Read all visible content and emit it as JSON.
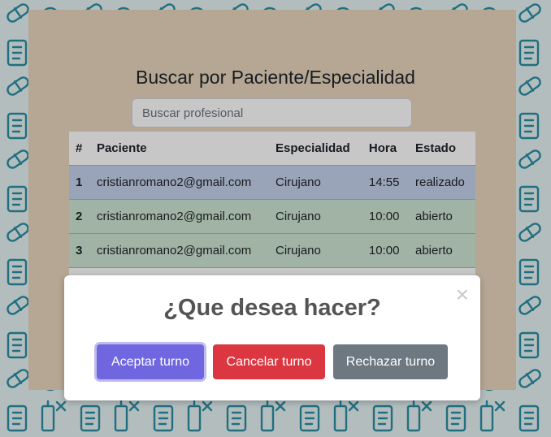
{
  "header": {
    "title": "Buscar por Paciente/Especialidad"
  },
  "search": {
    "placeholder": "Buscar profesional",
    "value": ""
  },
  "table": {
    "columns": [
      "#",
      "Paciente",
      "Especialidad",
      "Hora",
      "Estado"
    ],
    "rows": [
      {
        "num": "1",
        "paciente": "cristianromano2@gmail.com",
        "especialidad": "Cirujano",
        "hora": "14:55",
        "estado": "realizado",
        "status_color": "#c5d2ec"
      },
      {
        "num": "2",
        "paciente": "cristianromano2@gmail.com",
        "especialidad": "Cirujano",
        "hora": "10:00",
        "estado": "abierto",
        "status_color": "#cde6d3"
      },
      {
        "num": "3",
        "paciente": "cristianromano2@gmail.com",
        "especialidad": "Cirujano",
        "hora": "10:00",
        "estado": "abierto",
        "status_color": "#cde6d3"
      }
    ]
  },
  "modal": {
    "title": "¿Que desea hacer?",
    "close_icon": "close-icon",
    "close_symbol": "×",
    "buttons": {
      "accept": "Aceptar turno",
      "cancel": "Cancelar turno",
      "reject": "Rechazar turno"
    }
  },
  "colors": {
    "accept": "#7066e0",
    "cancel": "#dc3741",
    "reject": "#6e7881",
    "pattern": "#2a8fa5",
    "panel": "#e8d7bd"
  }
}
